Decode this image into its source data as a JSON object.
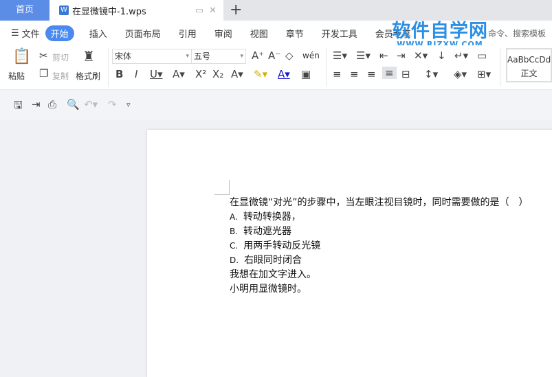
{
  "tabs": {
    "home": "首页",
    "document": "在显微镜中-1.wps",
    "new_tab": "+"
  },
  "menu": {
    "file": "文件",
    "items": [
      "开始",
      "插入",
      "页面布局",
      "引用",
      "审阅",
      "视图",
      "章节",
      "开发工具",
      "会员专享"
    ],
    "search_hint": "命令、搜索模板"
  },
  "watermark": {
    "title": "软件自学网",
    "url": "WWW.RJZXW.COM"
  },
  "ribbon": {
    "paste": "粘贴",
    "cut": "剪切",
    "copy": "复制",
    "format_painter": "格式刷",
    "font_name": "宋体",
    "font_size": "五号",
    "style_preview": "AaBbCcDd",
    "style_name": "正文",
    "pinyin": "wén"
  },
  "document": {
    "question": "在显微镜“对光”的步骤中，当左眼注视目镜时，同时需要做的是（　）",
    "options": [
      {
        "label": "A.",
        "text": "转动转换器，"
      },
      {
        "label": "B.",
        "text": "转动遮光器"
      },
      {
        "label": "C.",
        "text": "用两手转动反光镜"
      },
      {
        "label": "D.",
        "text": "右眼同时闭合"
      }
    ],
    "lines": [
      "我想在加文字进入。",
      "小明用显微镜时。"
    ]
  },
  "colors": {
    "accent": "#4a8af0",
    "home_tab": "#5b8ce6"
  }
}
